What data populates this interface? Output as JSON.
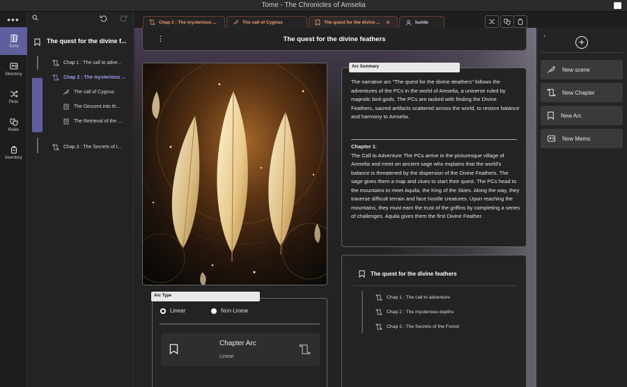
{
  "window": {
    "title": "Tome - The Chronicles of Amselia"
  },
  "leftbar": {
    "items": [
      {
        "label": "Tomy",
        "icon": "book-icon"
      },
      {
        "label": "Directory",
        "icon": "contact-card-icon"
      },
      {
        "label": "Plots",
        "icon": "shuffle-icon"
      },
      {
        "label": "Roles",
        "icon": "masks-icon"
      },
      {
        "label": "Inventory",
        "icon": "backpack-icon"
      }
    ]
  },
  "tree": {
    "root": "The quest for the divine f...",
    "items": [
      {
        "label": "Chap 1 : The call to adve..."
      },
      {
        "label": "Chap 2 : The mysterious ..."
      },
      {
        "label": "The call of Cygnus"
      },
      {
        "label": "The Descent into th..."
      },
      {
        "label": "The Retrieval of the ..."
      },
      {
        "label": "Chap 3 : The Secrets of t..."
      }
    ]
  },
  "tabs": [
    {
      "label": "Chap 2 : The mysterious ..."
    },
    {
      "label": "The call of Cygnus"
    },
    {
      "label": "The quest for the divine ..."
    },
    {
      "label": "Isolde"
    }
  ],
  "header": {
    "title": "The quest for the divine feathers"
  },
  "arc_type": {
    "tag": "Arc Type",
    "options": [
      "Linear",
      "Non-Linear"
    ],
    "selected": "Linear",
    "card_title": "Chapter Arc",
    "card_sub": "Linear"
  },
  "summary": {
    "tag": "Arc Summary",
    "text": "The narrative arc \"The quest for the divine deathers\" follows the adventures of the PCs in the world of Amselia, a universe ruled by majestic bird-gods. The PCs are tasked with finding the Divine Feathers, sacred artifacts scattered across the world, to restore balance and harmony to Amselia.",
    "chapter_heading": "Chapter 1",
    "chapter_text": "The Call to Adventure The PCs arrive in the picturesque village of Amselia and meet an ancient sage who explains that the world's balance is threatened by the dispersion of the Divine Feathers. The sage gives them a map and clues to start their quest. The PCs head to the mountains to meet Aquila, the King of the Skies. Along the way, they traverse difficult terrain and face hostile creatures. Upon reaching the mountains, they must earn the trust of the griffins by completing a series of challenges. Aquila gives them the first Divine Feather."
  },
  "outline": {
    "title": "The quest for the divine feathers",
    "items": [
      {
        "label": "Chap 1 : The call to adventure"
      },
      {
        "label": "Chap 2 : The mysterious depths"
      },
      {
        "label": "Chap 3 : The Secrets of the Forest"
      }
    ]
  },
  "actions": [
    {
      "label": "New scene",
      "icon": "feather-pen-icon"
    },
    {
      "label": "New Chapter",
      "icon": "scroll-icon"
    },
    {
      "label": "New Arc",
      "icon": "bookmark-icon"
    },
    {
      "label": "New Memo",
      "icon": "memo-card-icon"
    }
  ],
  "colors": {
    "accent": "#5f5f9e",
    "tab_text": "#f19c6b",
    "selected_tree": "#9a9bee"
  }
}
